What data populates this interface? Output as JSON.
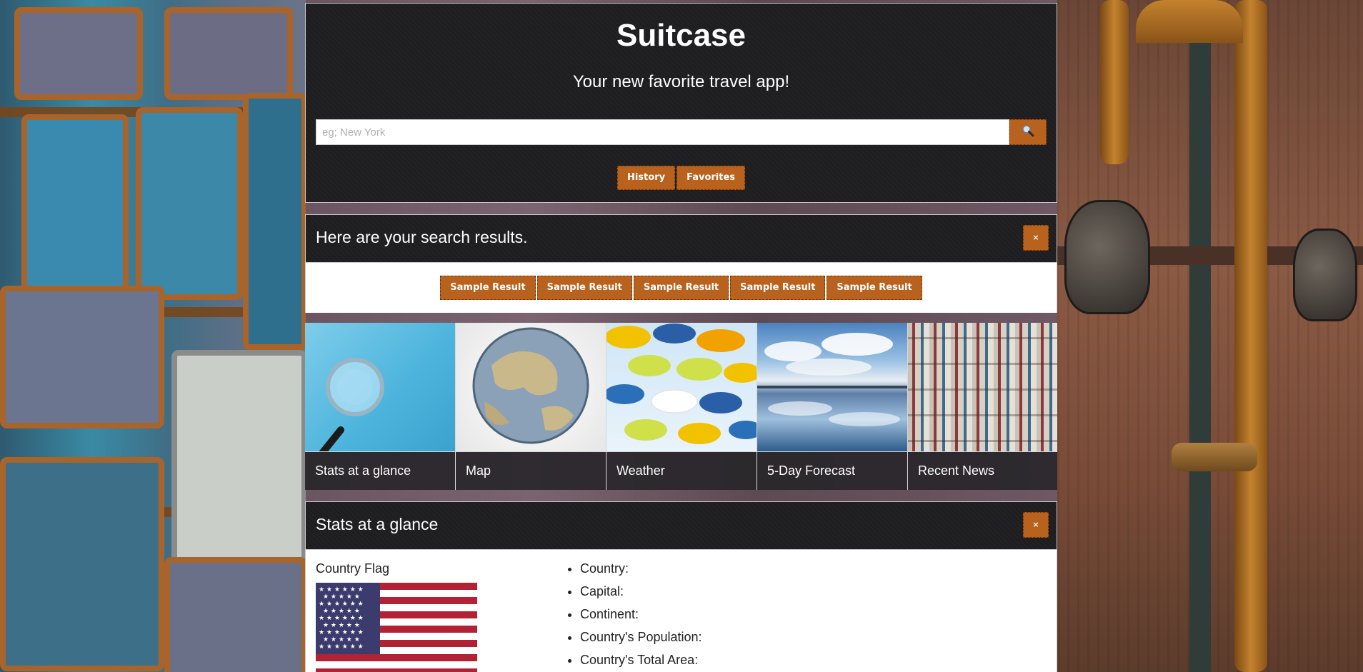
{
  "app": {
    "title": "Suitcase",
    "subtitle": "Your new favorite travel app!"
  },
  "search": {
    "placeholder": "eg; New York",
    "value": "",
    "button_icon": "search-icon"
  },
  "nav": {
    "history_label": "History",
    "favorites_label": "Favorites"
  },
  "results": {
    "heading": "Here are your search results.",
    "close_label": "×",
    "items": [
      {
        "label": "Sample Result"
      },
      {
        "label": "Sample Result"
      },
      {
        "label": "Sample Result"
      },
      {
        "label": "Sample Result"
      },
      {
        "label": "Sample Result"
      }
    ]
  },
  "tiles": [
    {
      "label": "Stats at a glance",
      "image": "magnifying-glass"
    },
    {
      "label": "Map",
      "image": "globe"
    },
    {
      "label": "Weather",
      "image": "umbrellas"
    },
    {
      "label": "5-Day Forecast",
      "image": "sky-lake"
    },
    {
      "label": "Recent News",
      "image": "magazines"
    }
  ],
  "stats": {
    "heading": "Stats at a glance",
    "close_label": "×",
    "flag_label": "Country Flag",
    "facts": [
      {
        "label": "Country:"
      },
      {
        "label": "Capital:"
      },
      {
        "label": "Continent:"
      },
      {
        "label": "Country's Population:"
      },
      {
        "label": "Country's Total Area:"
      }
    ]
  },
  "colors": {
    "accent": "#b8621e",
    "dark_panel": "#1e1d20",
    "flag_red": "#b22234",
    "flag_blue": "#3c3b6e"
  }
}
